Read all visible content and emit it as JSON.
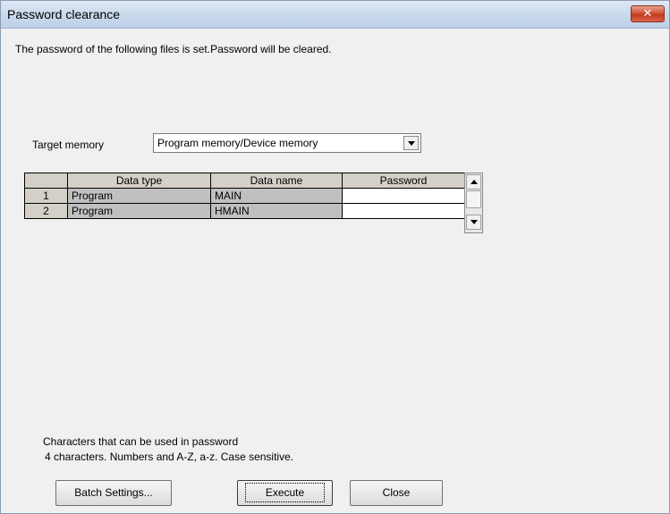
{
  "window": {
    "title": "Password clearance",
    "close_glyph": "✕"
  },
  "message": "The password of the following files is set.Password will be cleared.",
  "target_memory": {
    "label": "Target memory",
    "value": "Program memory/Device memory"
  },
  "table": {
    "columns": [
      "",
      "Data type",
      "Data name",
      "Password"
    ],
    "rows": [
      {
        "index": "1",
        "data_type": "Program",
        "data_name": "MAIN",
        "password": ""
      },
      {
        "index": "2",
        "data_type": "Program",
        "data_name": "HMAIN",
        "password": ""
      }
    ]
  },
  "note": {
    "line1": "Characters that can be used in password",
    "line2": "4 characters. Numbers and A-Z, a-z. Case sensitive."
  },
  "buttons": {
    "batch_settings": "Batch Settings...",
    "execute": "Execute",
    "close": "Close"
  },
  "icons": {
    "close": "close-icon",
    "dropdown": "chevron-down-icon",
    "scroll_up": "triangle-up-icon",
    "scroll_down": "triangle-down-icon"
  },
  "colors": {
    "titlebar": "#c9d9ec",
    "close_button": "#c23a1f",
    "readonly_cell": "#c0c0c0",
    "header_cell": "#d4d0c8"
  }
}
